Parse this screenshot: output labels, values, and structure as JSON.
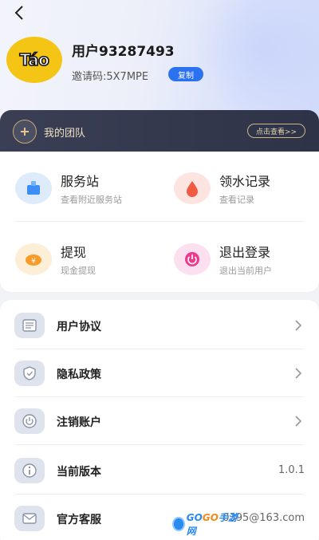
{
  "header": {
    "username": "用户93287493",
    "invite_text": "邀请码:5X7MPE",
    "copy_label": "复制",
    "avatar_text": "Táo"
  },
  "team": {
    "title": "我的团队",
    "view_label": "点击查看>>"
  },
  "grid": [
    {
      "title": "服务站",
      "subtitle": "查看附近服务站",
      "icon": "service-station-icon"
    },
    {
      "title": "领水记录",
      "subtitle": "查看记录",
      "icon": "water-drop-icon"
    },
    {
      "title": "提现",
      "subtitle": "现金提现",
      "icon": "money-bag-icon"
    },
    {
      "title": "退出登录",
      "subtitle": "退出当前用户",
      "icon": "power-icon"
    }
  ],
  "list": [
    {
      "label": "用户协议",
      "icon": "document-icon"
    },
    {
      "label": "隐私政策",
      "icon": "shield-icon"
    },
    {
      "label": "注销账户",
      "icon": "power-icon"
    },
    {
      "label": "当前版本",
      "value": "1.0.1",
      "icon": "info-icon"
    },
    {
      "label": "官方客服",
      "value": "0395@163.com",
      "icon": "mail-icon"
    }
  ],
  "watermark": {
    "text1": "GO",
    "text2": "GO",
    "text3": "手游网"
  },
  "colors": {
    "accent": "#2a72f0",
    "team_bar": "#343a50",
    "gold": "#cfb587"
  }
}
